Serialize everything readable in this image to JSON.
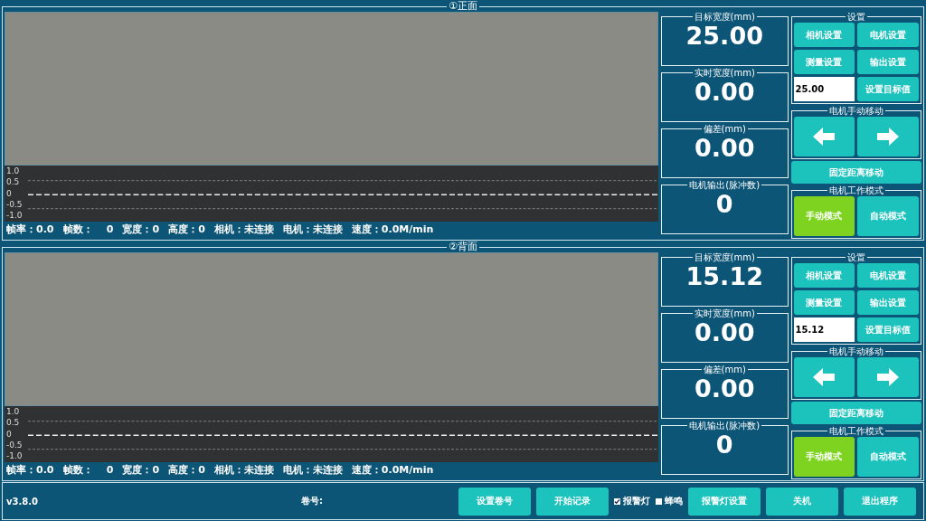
{
  "panels": [
    {
      "title": "①正面",
      "y_ticks": [
        "1.0",
        "0.5",
        "0",
        "-0.5",
        "-1.0"
      ],
      "status": [
        "帧率：0.0",
        "帧数：    0",
        "宽度：0",
        "高度：0",
        "相机：未连接",
        "电机：未连接",
        "速度：0.0M/min"
      ],
      "readouts": [
        {
          "label": "目标宽度(mm)",
          "value": "25.00"
        },
        {
          "label": "实时宽度(mm)",
          "value": "0.00"
        },
        {
          "label": "偏差(mm)",
          "value": "0.00"
        },
        {
          "label": "电机输出(脉冲数)",
          "value": "0"
        }
      ],
      "settings": {
        "title": "设置",
        "buttons": [
          "相机设置",
          "电机设置",
          "测量设置",
          "输出设置"
        ],
        "target_value": "25.00",
        "set_button": "设置目标值"
      },
      "manual": {
        "title": "电机手动移动",
        "fixed_button": "固定距离移动"
      },
      "mode": {
        "title": "电机工作模式",
        "options": [
          {
            "label": "手动模式",
            "selected": true
          },
          {
            "label": "自动模式",
            "selected": false
          }
        ]
      }
    },
    {
      "title": "②背面",
      "y_ticks": [
        "1.0",
        "0.5",
        "0",
        "-0.5",
        "-1.0"
      ],
      "status": [
        "帧率：0.0",
        "帧数：    0",
        "宽度：0",
        "高度：0",
        "相机：未连接",
        "电机：未连接",
        "速度：0.0M/min"
      ],
      "readouts": [
        {
          "label": "目标宽度(mm)",
          "value": "15.12"
        },
        {
          "label": "实时宽度(mm)",
          "value": "0.00"
        },
        {
          "label": "偏差(mm)",
          "value": "0.00"
        },
        {
          "label": "电机输出(脉冲数)",
          "value": "0"
        }
      ],
      "settings": {
        "title": "设置",
        "buttons": [
          "相机设置",
          "电机设置",
          "测量设置",
          "输出设置"
        ],
        "target_value": "15.12",
        "set_button": "设置目标值"
      },
      "manual": {
        "title": "电机手动移动",
        "fixed_button": "固定距离移动"
      },
      "mode": {
        "title": "电机工作模式",
        "options": [
          {
            "label": "手动模式",
            "selected": true
          },
          {
            "label": "自动模式",
            "selected": false
          }
        ]
      }
    }
  ],
  "footer": {
    "version": "v3.8.0",
    "roll_label": "卷号:",
    "buttons_left": [
      "设置卷号",
      "开始记录"
    ],
    "checks": [
      {
        "label": "报警灯",
        "checked": true
      },
      {
        "label": "蜂鸣",
        "checked": false
      }
    ],
    "buttons_right": [
      "报警灯设置",
      "关机",
      "退出程序"
    ]
  }
}
